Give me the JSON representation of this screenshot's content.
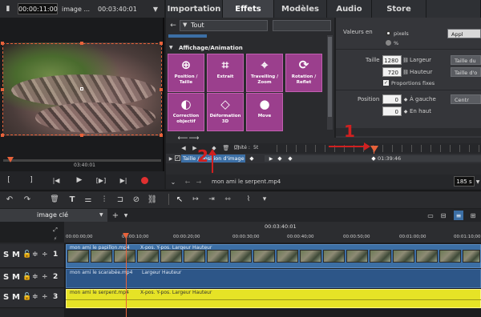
{
  "preview": {
    "timecode": "00:00:11:00",
    "clip_name": "image ...",
    "duration": "00:03:40:01",
    "position": "03:40:01"
  },
  "tabs": [
    {
      "label": "Importation"
    },
    {
      "label": "Effets"
    },
    {
      "label": "Modèles"
    },
    {
      "label": "Audio"
    },
    {
      "label": "Store"
    }
  ],
  "effects": {
    "filter": "Tout",
    "category": "Affichage/Animation",
    "tiles": [
      {
        "label": "Position / Taille",
        "icon": "position-size-icon"
      },
      {
        "label": "Extrait",
        "icon": "crop-icon"
      },
      {
        "label": "Travelling / Zoom",
        "icon": "camera-zoom-icon"
      },
      {
        "label": "Rotation / Reflet",
        "icon": "rotation-icon"
      },
      {
        "label": "Correction objectif",
        "icon": "lens-correction-icon"
      },
      {
        "label": "Déformation 3D",
        "icon": "3d-deform-icon"
      },
      {
        "label": "Move",
        "icon": "move-icon"
      }
    ]
  },
  "properties": {
    "units_label": "Valeurs en",
    "unit_pixels": "pixels",
    "unit_percent": "%",
    "apply_button": "Appl",
    "size_label": "Taille",
    "width_value": "1280",
    "width_label": "Largeur",
    "height_value": "720",
    "height_label": "Hauteur",
    "keep_ratio": "Proportions fixes",
    "size_btn1": "Taille du",
    "size_btn2": "Taille d'o",
    "position_label": "Position",
    "pos_x_value": "0",
    "pos_x_label": "À gauche",
    "pos_x_btn": "Centr",
    "pos_y_value": "0",
    "pos_y_label": "En haut"
  },
  "keyframes": {
    "unit_label": "Unité :",
    "unit_value": "5t",
    "track_label": "Taille / position d'image",
    "time": "01:39:46"
  },
  "annotations": {
    "marker1": "1",
    "marker2": "2"
  },
  "object_bar": {
    "clip_name": "mon ami le serpent.mp4",
    "duration": "185 s"
  },
  "timeline": {
    "tab": "image clé",
    "timecode": "00:03:40:01",
    "ruler": [
      "00:00:00;00",
      "00:00:10;00",
      "00:00:20;00",
      "00:00:30;00",
      "00:00:40;00",
      "00:00:50;00",
      "00:01:00;00",
      "00:01:10;00"
    ],
    "tracks": [
      {
        "number": "1",
        "S": "S",
        "M": "M",
        "clip": "mon ami le papillon.mp4",
        "params": "X-pos.  Y-pos.  Largeur  Hauteur"
      },
      {
        "number": "2",
        "S": "S",
        "M": "M",
        "clip": "mon ami le scarabée.mp4",
        "params": "Largeur  Hauteur"
      },
      {
        "number": "3",
        "S": "S",
        "M": "M",
        "clip": "mon ami le serpent.mp4",
        "params": "X-pos.  Y-pos.  Largeur  Hauteur"
      }
    ]
  },
  "colors": {
    "accent_orange": "#e8623a",
    "tile_purple": "#9b3f8d",
    "clip_yellow": "#e6e326",
    "clip_blue": "#3c6fa5",
    "annotation_red": "#d02020"
  }
}
